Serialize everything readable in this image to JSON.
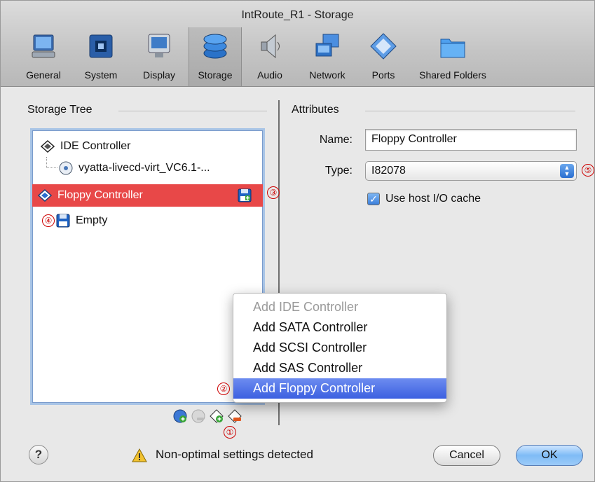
{
  "window": {
    "title": "IntRoute_R1 - Storage"
  },
  "toolbar": {
    "items": [
      {
        "label": "General",
        "icon": "monitor-general-icon"
      },
      {
        "label": "System",
        "icon": "chip-icon"
      },
      {
        "label": "Display",
        "icon": "display-icon"
      },
      {
        "label": "Storage",
        "icon": "storage-disks-icon"
      },
      {
        "label": "Audio",
        "icon": "speaker-icon"
      },
      {
        "label": "Network",
        "icon": "network-icon"
      },
      {
        "label": "Ports",
        "icon": "ports-icon"
      },
      {
        "label": "Shared Folders",
        "icon": "folder-icon"
      }
    ],
    "active": "Storage"
  },
  "storage_tree": {
    "heading": "Storage Tree",
    "items": [
      {
        "label": "IDE Controller",
        "icon": "ide-controller-icon"
      },
      {
        "label": "vyatta-livecd-virt_VC6.1-...",
        "icon": "cd-disc-icon"
      },
      {
        "label": "Floppy Controller",
        "icon": "floppy-controller-icon",
        "selected": true
      },
      {
        "label": "Empty",
        "icon": "floppy-disk-icon"
      }
    ],
    "bottom_buttons": [
      "add-disk-icon",
      "remove-disk-icon",
      "add-controller-icon",
      "remove-controller-icon"
    ]
  },
  "attributes": {
    "heading": "Attributes",
    "name_label": "Name:",
    "name_value": "Floppy Controller",
    "type_label": "Type:",
    "type_value": "I82078",
    "host_cache_label": "Use host I/O cache",
    "host_cache_checked": true
  },
  "menu": {
    "items": [
      {
        "label": "Add IDE Controller",
        "disabled": true
      },
      {
        "label": "Add SATA Controller"
      },
      {
        "label": "Add SCSI Controller"
      },
      {
        "label": "Add SAS Controller"
      },
      {
        "label": "Add Floppy Controller",
        "highlighted": true
      }
    ]
  },
  "callouts": {
    "c1": "①",
    "c2": "②",
    "c3": "③",
    "c4": "④",
    "c5": "⑤"
  },
  "footer": {
    "help": "?",
    "warning": "Non-optimal settings detected",
    "cancel": "Cancel",
    "ok": "OK"
  },
  "colors": {
    "selection": "#e84848",
    "menu_highlight": "#3c60e0",
    "callout": "#cc0000"
  }
}
